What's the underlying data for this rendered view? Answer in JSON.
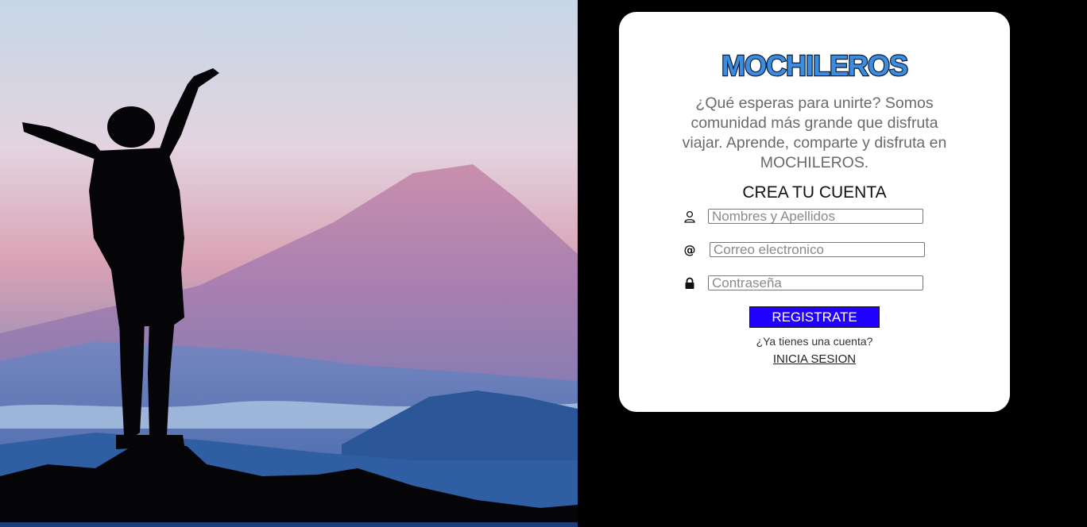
{
  "brand": {
    "logo_text": "MOCHILEROS",
    "logo_fill": "#3a8de0",
    "logo_outline": "#0b1a33"
  },
  "hero": {
    "description": "",
    "icon": "traveler-silhouette"
  },
  "signup": {
    "tagline": "¿Qué esperas para unirte? Somos comunidad más grande que disfruta viajar. Aprende, comparte y disfruta en MOCHILEROS.",
    "title": "CREA TU CUENTA",
    "fields": [
      {
        "icon": "user-icon",
        "placeholder": "Nombres y Apellidos"
      },
      {
        "icon": "at-icon",
        "placeholder": "Correo electronico"
      },
      {
        "icon": "lock-icon",
        "placeholder": "Contraseña"
      }
    ],
    "submit_label": "REGISTRATE",
    "login_prompt": "¿Ya tienes una cuenta?",
    "login_link": "INICIA SESION"
  },
  "colors": {
    "background": "#000000",
    "card": "#ffffff",
    "button": "#2200ff"
  }
}
